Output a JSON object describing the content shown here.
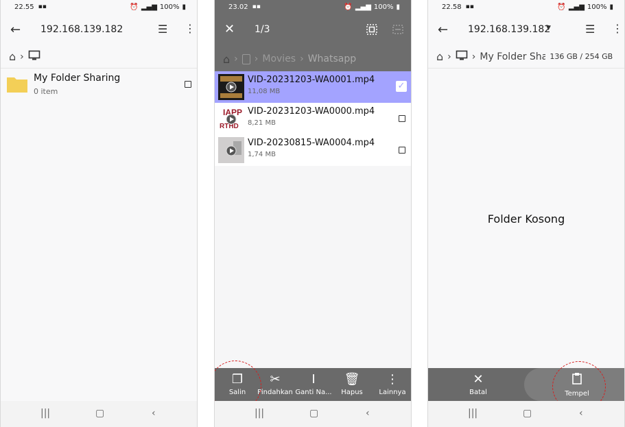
{
  "screen1": {
    "time": "22.55",
    "battery": "100%",
    "title": "192.168.139.182",
    "folder": {
      "name": "My Folder Sharing",
      "meta": "0 item"
    }
  },
  "screen2": {
    "time": "23.02",
    "battery": "100%",
    "count": "1/3",
    "crumbs": [
      "Movies",
      "Whatsapp"
    ],
    "files": [
      {
        "name": "VID-20231203-WA0001.mp4",
        "size": "11,08 MB",
        "selected": true
      },
      {
        "name": "VID-20231203-WA0000.mp4",
        "size": "8,21 MB",
        "selected": false
      },
      {
        "name": "VID-20230815-WA0004.mp4",
        "size": "1,74 MB",
        "selected": false
      }
    ],
    "actions": {
      "copy": "Salin",
      "move": "Pindahkan",
      "rename": "Ganti Na...",
      "delete": "Hapus",
      "more": "Lainnya"
    }
  },
  "screen3": {
    "time": "22.58",
    "battery": "100%",
    "title": "192.168.139.182",
    "crumb": "My Folder Sha",
    "storage": "136 GB / 254 GB",
    "empty": "Folder Kosong",
    "actions": {
      "cancel": "Batal",
      "paste": "Tempel"
    }
  },
  "colors": {
    "selected_row": "#a3a3ff",
    "folder": "#f3cf57",
    "annotation": "#d61f1f",
    "dim": "#6d6d6d"
  }
}
